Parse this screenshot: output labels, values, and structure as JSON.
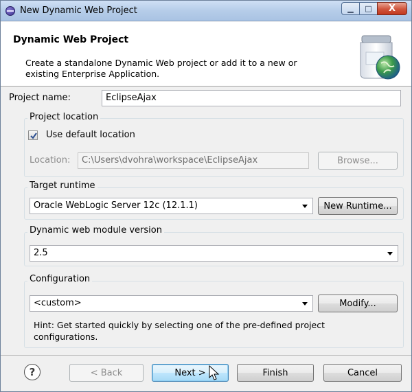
{
  "window": {
    "title": "New Dynamic Web Project",
    "minimize_glyph": "▁",
    "maximize_glyph": "□",
    "close_glyph": "X"
  },
  "banner": {
    "title": "Dynamic Web Project",
    "description": "Create a standalone Dynamic Web project or add it to a new or existing Enterprise Application."
  },
  "project_name": {
    "label": "Project name:",
    "value": "EclipseAjax"
  },
  "project_location": {
    "group_title": "Project location",
    "use_default_label": "Use default location",
    "use_default_checked": true,
    "location_label": "Location:",
    "location_value": "C:\\Users\\dvohra\\workspace\\EclipseAjax",
    "browse_label": "Browse..."
  },
  "target_runtime": {
    "group_title": "Target runtime",
    "selected": "Oracle WebLogic Server 12c (12.1.1)",
    "new_runtime_label": "New Runtime..."
  },
  "module_version": {
    "group_title": "Dynamic web module version",
    "selected": "2.5"
  },
  "configuration": {
    "group_title": "Configuration",
    "selected": "<custom>",
    "modify_label": "Modify...",
    "hint": "Hint: Get started quickly by selecting one of the pre-defined project configurations."
  },
  "footer": {
    "help_glyph": "?",
    "back_label": "< Back",
    "next_label": "Next >",
    "finish_label": "Finish",
    "cancel_label": "Cancel"
  },
  "colors": {
    "dialog_bg": "#f0f0f0",
    "titlebar": "#b6cde9",
    "close_button": "#c2381f",
    "default_button": "#3c7fb1"
  }
}
